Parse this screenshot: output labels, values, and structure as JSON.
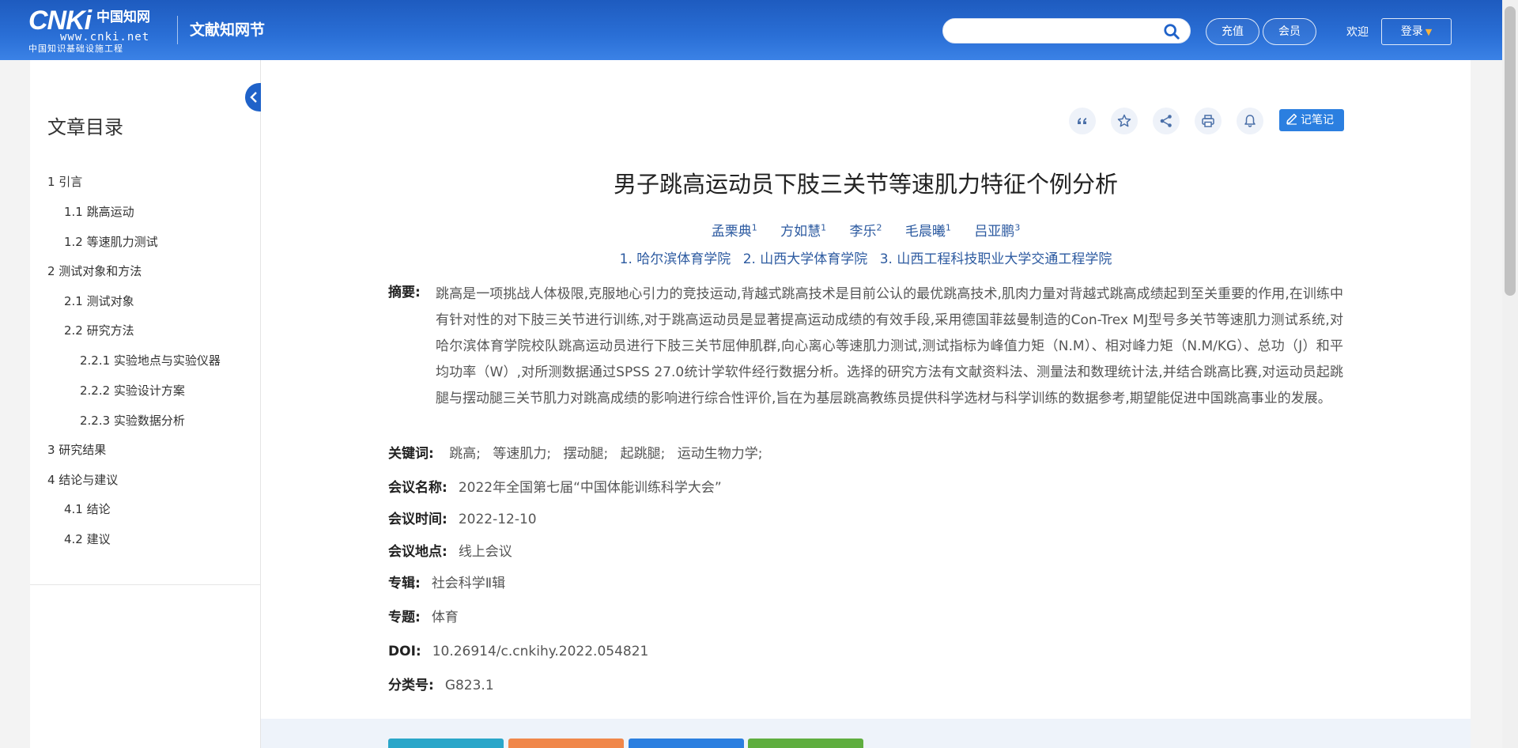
{
  "header": {
    "logo_brand": "CNKi",
    "logo_cn": "中国知网",
    "logo_url": "www.cnki.net",
    "logo_tag": "中国知识基础设施工程",
    "site_name": "文献知网节",
    "search_placeholder": "",
    "recharge_label": "充值",
    "vip_label": "会员",
    "welcome_text": "欢迎",
    "login_label": "登录"
  },
  "sidebar": {
    "title": "文章目录",
    "items": [
      {
        "label": "1 引言"
      },
      {
        "label": "1.1 跳高运动"
      },
      {
        "label": "1.2 等速肌力测试"
      },
      {
        "label": "2 测试对象和方法"
      },
      {
        "label": "2.1 测试对象"
      },
      {
        "label": "2.2 研究方法"
      },
      {
        "label": "2.2.1 实验地点与实验仪器"
      },
      {
        "label": "2.2.2 实验设计方案"
      },
      {
        "label": "2.2.3 实验数据分析"
      },
      {
        "label": "3 研究结果"
      },
      {
        "label": "4 结论与建议"
      },
      {
        "label": "4.1 结论"
      },
      {
        "label": "4.2 建议"
      }
    ]
  },
  "toolbar": {
    "note_label": "记笔记",
    "icons": [
      "quote-icon",
      "star-icon",
      "share-icon",
      "print-icon",
      "bell-icon"
    ]
  },
  "paper": {
    "title": "男子跳高运动员下肢三关节等速肌力特征个例分析",
    "authors": [
      {
        "name": "孟栗典",
        "sup": "1"
      },
      {
        "name": "方如慧",
        "sup": "1"
      },
      {
        "name": "李乐",
        "sup": "2"
      },
      {
        "name": "毛晨曦",
        "sup": "1"
      },
      {
        "name": "吕亚鹏",
        "sup": "3"
      }
    ],
    "affiliations": [
      "1. 哈尔滨体育学院",
      "2. 山西大学体育学院",
      "3. 山西工程科技职业大学交通工程学院"
    ],
    "abstract_label": "摘要:",
    "abstract": "跳高是一项挑战人体极限,克服地心引力的竞技运动,背越式跳高技术是目前公认的最优跳高技术,肌肉力量对背越式跳高成绩起到至关重要的作用,在训练中有针对性的对下肢三关节进行训练,对于跳高运动员是显著提高运动成绩的有效手段,采用德国菲兹曼制造的Con-Trex MJ型号多关节等速肌力测试系统,对哈尔滨体育学院校队跳高运动员进行下肢三关节屈伸肌群,向心离心等速肌力测试,测试指标为峰值力矩（N.M）、相对峰力矩（N.M/KG）、总功（J）和平均功率（W）,对所测数据通过SPSS 27.0统计学软件经行数据分析。选择的研究方法有文献资料法、测量法和数理统计法,并结合跳高比赛,对运动员起跳腿与摆动腿三关节肌力对跳高成绩的影响进行综合性评价,旨在为基层跳高教练员提供科学选材与科学训练的数据参考,期望能促进中国跳高事业的发展。",
    "keywords_label": "关键词:",
    "keywords": [
      "跳高;",
      "等速肌力;",
      "摆动腿;",
      "起跳腿;",
      "运动生物力学;"
    ],
    "conf_name_label": "会议名称:",
    "conf_name": "2022年全国第七届“中国体能训练科学大会”",
    "conf_time_label": "会议时间:",
    "conf_time": "2022-12-10",
    "conf_place_label": "会议地点:",
    "conf_place": "线上会议",
    "series_label": "专辑:",
    "series": "社会科学Ⅱ辑",
    "subject_label": "专题:",
    "subject": "体育",
    "doi_label": "DOI:",
    "doi": "10.26914/c.cnkihy.2022.054821",
    "class_label": "分类号:",
    "class_no": "G823.1"
  },
  "colors": {
    "header_blue": "#2a6fd6",
    "link_blue": "#2c5aa0",
    "note_button": "#2b7fe0",
    "action_teal": "#2aa6c9",
    "action_orange": "#f0874a",
    "action_blue": "#2b7fe0",
    "action_green": "#5fae3f"
  }
}
